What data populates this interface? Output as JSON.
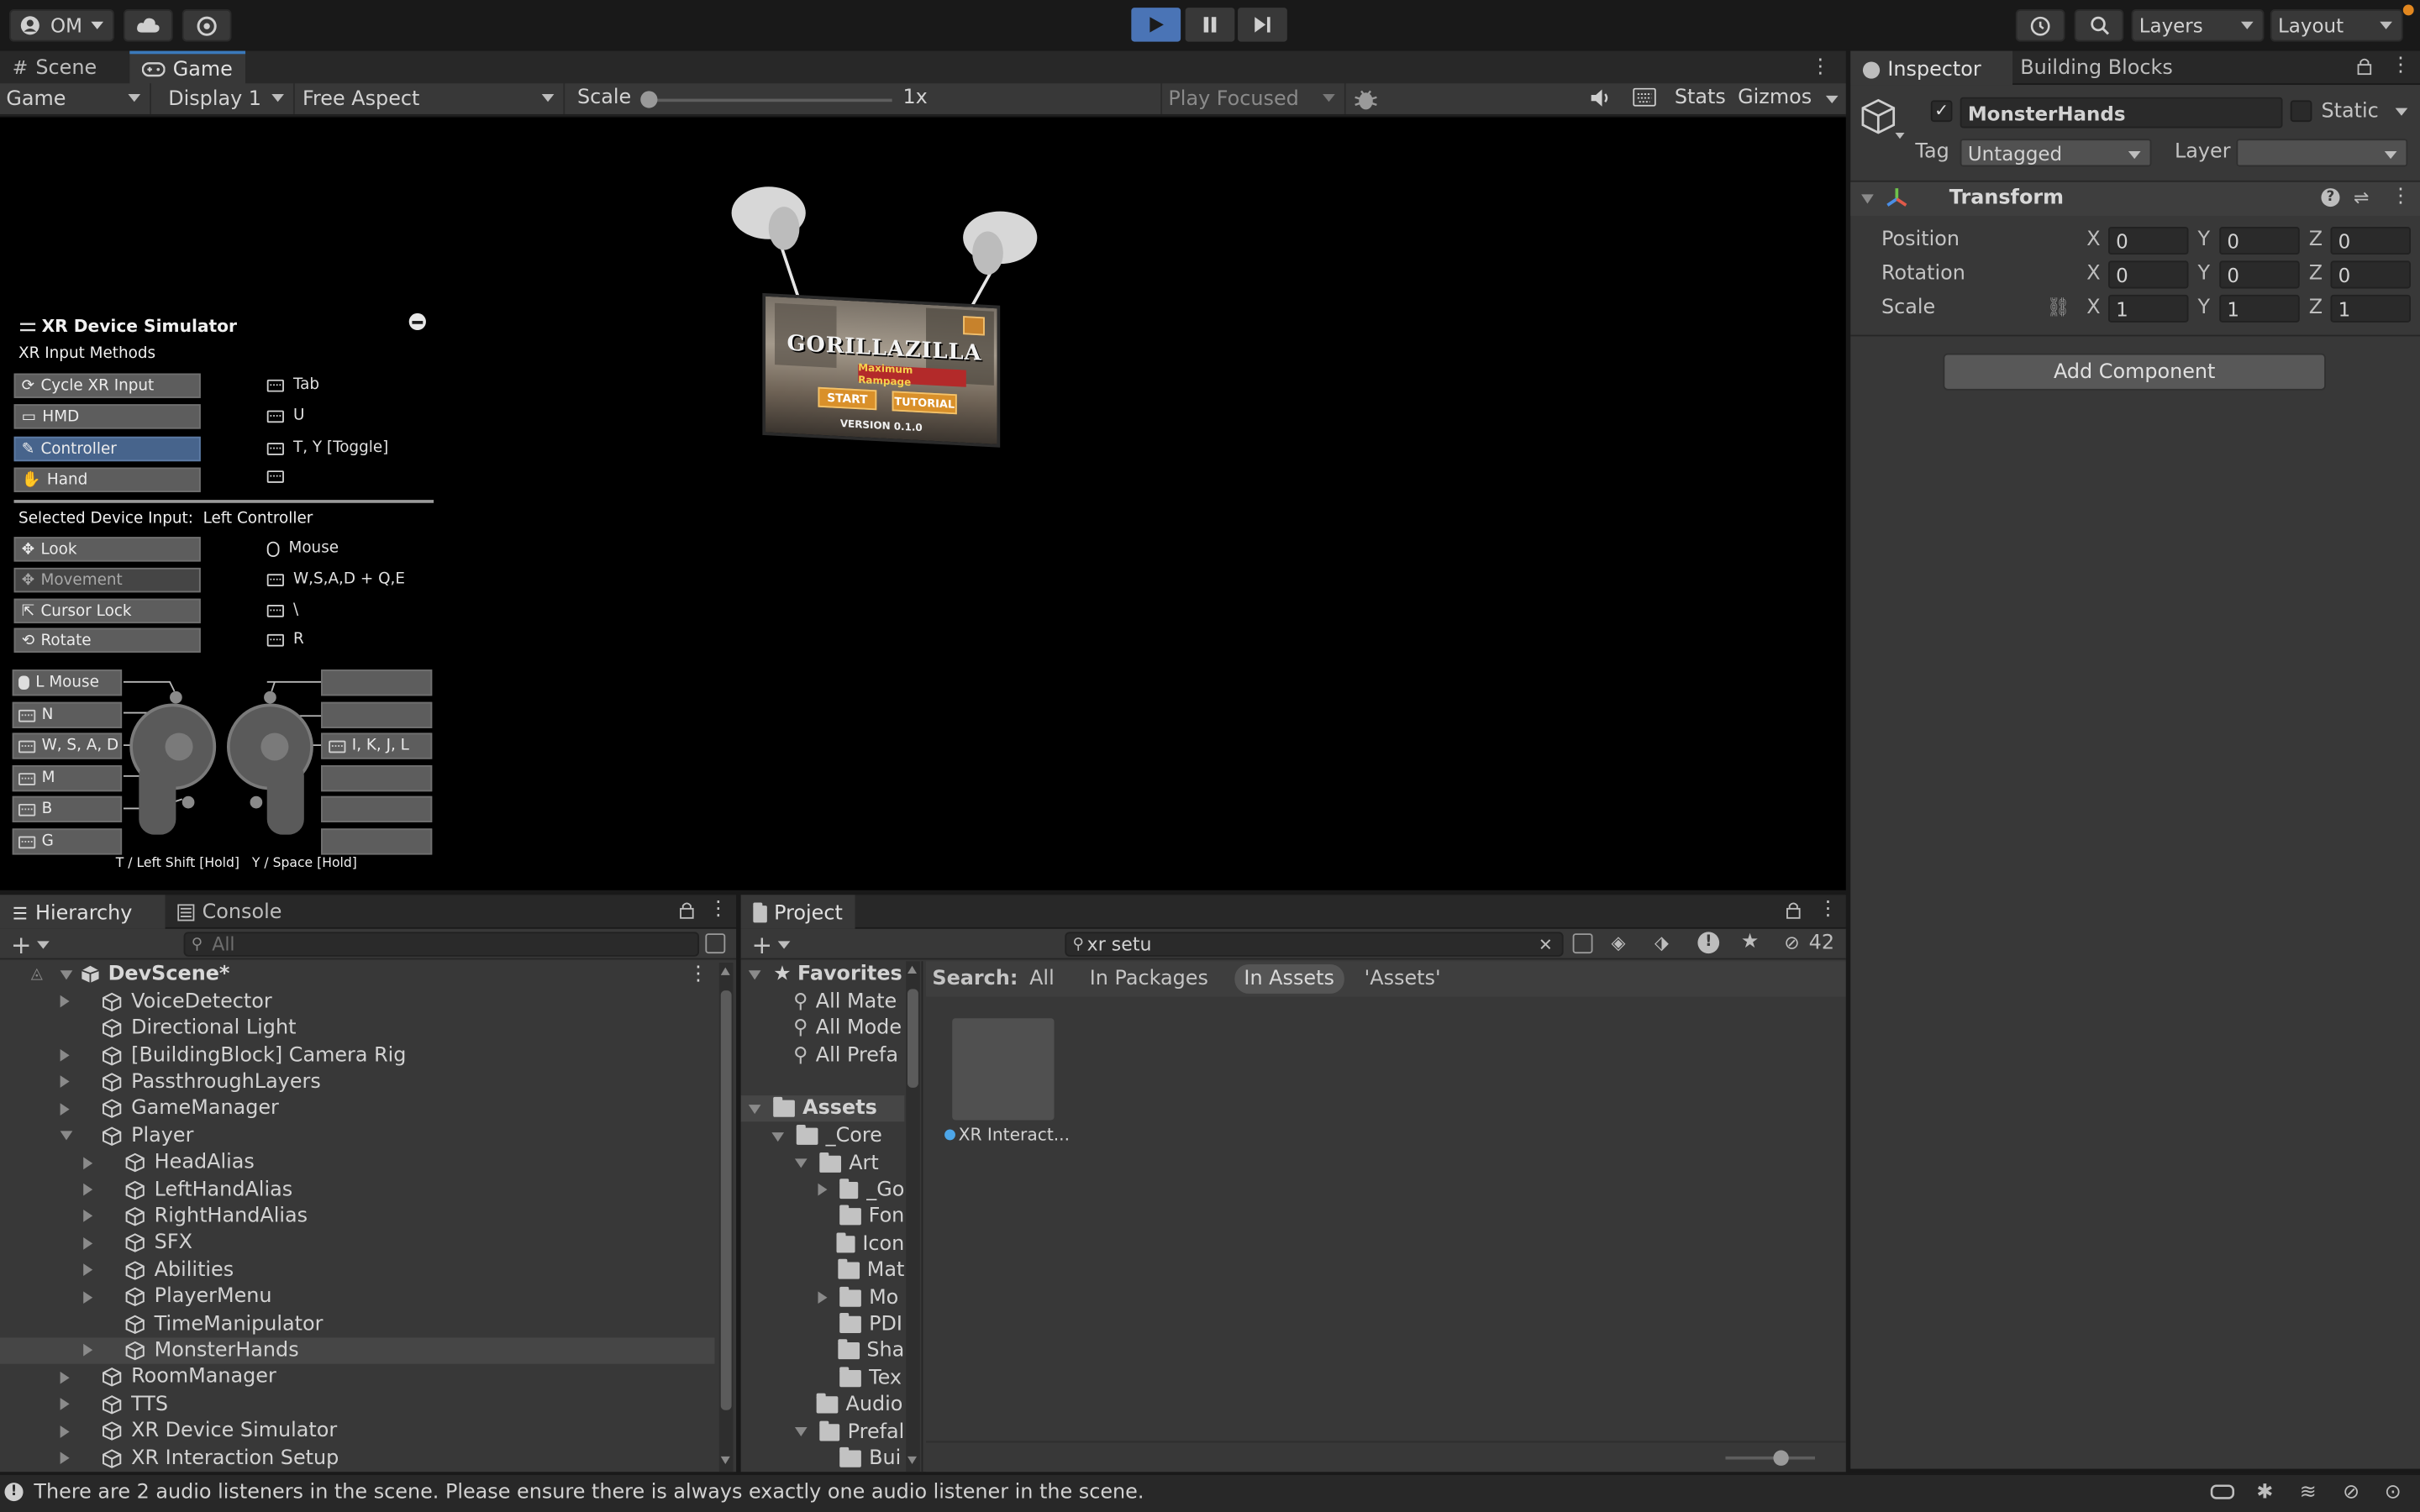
{
  "toolbar": {
    "account_label": "OM",
    "layers_label": "Layers",
    "layout_label": "Layout"
  },
  "colors": {
    "accent": "#3a79bb",
    "play_active": "#4a74b6"
  },
  "scene_game": {
    "tabs": [
      {
        "label": "Scene",
        "icon": "hash-icon"
      },
      {
        "label": "Game",
        "icon": "gamepad-icon"
      }
    ],
    "game_dropdown": "Game",
    "display_dropdown": "Display 1",
    "aspect_dropdown": "Free Aspect",
    "scale_label": "Scale",
    "scale_value": "1x",
    "play_focused": "Play Focused",
    "stats_label": "Stats",
    "gizmos_label": "Gizmos"
  },
  "game_view": {
    "banner_title": "GORILLAZILLA",
    "banner_subtitle": "Maximum Rampage",
    "start_label": "START",
    "tutorial_label": "TUTORIAL",
    "version": "VERSION 0.1.0"
  },
  "xr_sim": {
    "title": "XR Device Simulator",
    "input_methods_heading": "XR Input Methods",
    "methods": [
      {
        "label": "Cycle XR Input",
        "key": "Tab",
        "selected": false
      },
      {
        "label": "HMD",
        "key": "U",
        "selected": false
      },
      {
        "label": "Controller",
        "key": "T, Y [Toggle]",
        "selected": true
      },
      {
        "label": "Hand",
        "key": "",
        "selected": false
      }
    ],
    "selected_device": "Selected Device Input:  Left Controller",
    "actions": [
      {
        "label": "Look",
        "key": "Mouse"
      },
      {
        "label": "Movement",
        "key": "W,S,A,D + Q,E"
      },
      {
        "label": "Cursor Lock",
        "key": "\\"
      },
      {
        "label": "Rotate",
        "key": "R"
      }
    ],
    "left_buttons": [
      "L Mouse",
      "N",
      "W, S, A, D",
      "M",
      "B",
      "G"
    ],
    "right_buttons": [
      "",
      "",
      "I, K, J, L",
      "",
      "",
      ""
    ],
    "footer": "T / Left Shift [Hold]   Y / Space [Hold]"
  },
  "inspector": {
    "tabs": [
      "Inspector",
      "Building Blocks"
    ],
    "object_name": "MonsterHands",
    "static_label": "Static",
    "tag_label": "Tag",
    "tag_value": "Untagged",
    "layer_label": "Layer",
    "layer_value": "",
    "component_title": "Transform",
    "rows": [
      {
        "label": "Position",
        "x": "0",
        "y": "0",
        "z": "0"
      },
      {
        "label": "Rotation",
        "x": "0",
        "y": "0",
        "z": "0"
      },
      {
        "label": "Scale",
        "x": "1",
        "y": "1",
        "z": "1"
      }
    ],
    "add_component": "Add Component"
  },
  "hierarchy": {
    "tabs": [
      "Hierarchy",
      "Console"
    ],
    "search_placeholder": "All",
    "scene_name": "DevScene*",
    "items": [
      {
        "label": "VoiceDetector",
        "depth": 1,
        "expand": "collapsed"
      },
      {
        "label": "Directional Light",
        "depth": 1,
        "expand": "none"
      },
      {
        "label": "[BuildingBlock] Camera Rig",
        "depth": 1,
        "expand": "collapsed"
      },
      {
        "label": "PassthroughLayers",
        "depth": 1,
        "expand": "collapsed"
      },
      {
        "label": "GameManager",
        "depth": 1,
        "expand": "collapsed"
      },
      {
        "label": "Player",
        "depth": 1,
        "expand": "expanded"
      },
      {
        "label": "HeadAlias",
        "depth": 2,
        "expand": "collapsed"
      },
      {
        "label": "LeftHandAlias",
        "depth": 2,
        "expand": "collapsed"
      },
      {
        "label": "RightHandAlias",
        "depth": 2,
        "expand": "collapsed"
      },
      {
        "label": "SFX",
        "depth": 2,
        "expand": "collapsed"
      },
      {
        "label": "Abilities",
        "depth": 2,
        "expand": "collapsed"
      },
      {
        "label": "PlayerMenu",
        "depth": 2,
        "expand": "collapsed"
      },
      {
        "label": "TimeManipulator",
        "depth": 2,
        "expand": "none"
      },
      {
        "label": "MonsterHands",
        "depth": 2,
        "expand": "collapsed",
        "selected": true
      },
      {
        "label": "RoomManager",
        "depth": 1,
        "expand": "collapsed"
      },
      {
        "label": "TTS",
        "depth": 1,
        "expand": "collapsed"
      },
      {
        "label": "XR Device Simulator",
        "depth": 1,
        "expand": "collapsed"
      },
      {
        "label": "XR Interaction Setup",
        "depth": 1,
        "expand": "collapsed"
      }
    ]
  },
  "project": {
    "tab": "Project",
    "search_value": "xr setu",
    "hidden_count": "42",
    "search_label": "Search:",
    "filters": [
      "All",
      "In Packages",
      "In Assets",
      "'Assets'"
    ],
    "active_filter": "In Assets",
    "favorites_label": "Favorites",
    "favorites": [
      "All Mate",
      "All Mode",
      "All Prefa"
    ],
    "assets_label": "Assets",
    "tree": [
      {
        "label": "_Core",
        "depth": 1,
        "expand": "expanded"
      },
      {
        "label": "Art",
        "depth": 2,
        "expand": "expanded"
      },
      {
        "label": "_Go",
        "depth": 3,
        "expand": "collapsed"
      },
      {
        "label": "Fon",
        "depth": 3,
        "expand": "none"
      },
      {
        "label": "Icon",
        "depth": 3,
        "expand": "none"
      },
      {
        "label": "Mat",
        "depth": 3,
        "expand": "none"
      },
      {
        "label": "Mo",
        "depth": 3,
        "expand": "collapsed"
      },
      {
        "label": "PDI",
        "depth": 3,
        "expand": "none"
      },
      {
        "label": "Sha",
        "depth": 3,
        "expand": "none"
      },
      {
        "label": "Tex",
        "depth": 3,
        "expand": "none"
      },
      {
        "label": "Audio",
        "depth": 2,
        "expand": "none"
      },
      {
        "label": "Prefal",
        "depth": 2,
        "expand": "expanded"
      },
      {
        "label": "Bui",
        "depth": 3,
        "expand": "none"
      }
    ],
    "result_label": "XR Interact..."
  },
  "status_bar": {
    "message": "There are 2 audio listeners in the scene. Please ensure there is always exactly one audio listener in the scene."
  }
}
